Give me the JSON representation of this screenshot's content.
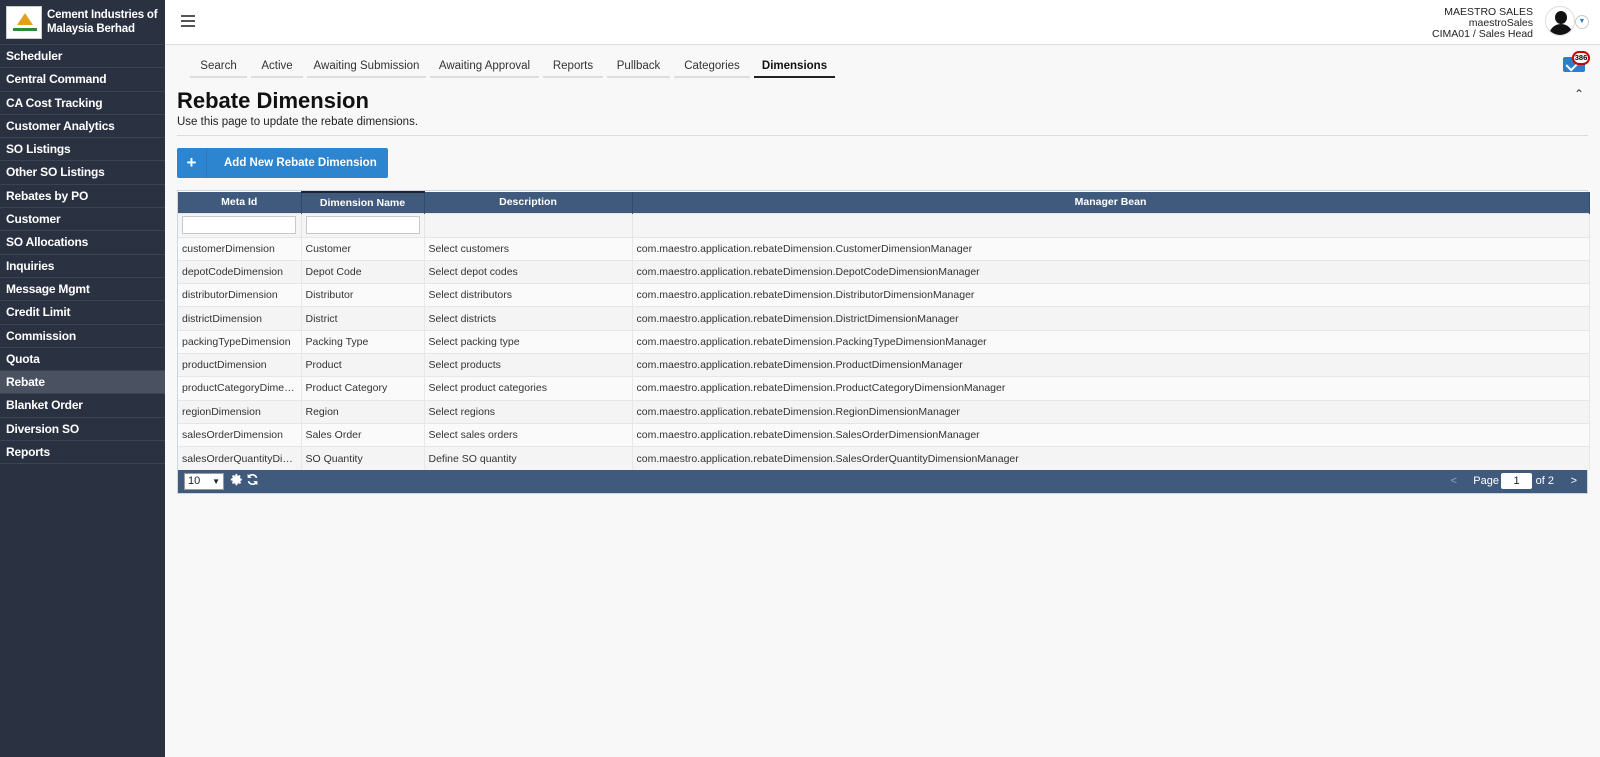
{
  "brand": {
    "name": "Cement Industries of Malaysia Berhad"
  },
  "sidebar": {
    "items": [
      {
        "label": "Scheduler",
        "name": "sidebar-item-scheduler"
      },
      {
        "label": "Central Command",
        "name": "sidebar-item-central-command"
      },
      {
        "label": "CA Cost Tracking",
        "name": "sidebar-item-ca-cost-tracking"
      },
      {
        "label": "Customer Analytics",
        "name": "sidebar-item-customer-analytics"
      },
      {
        "label": "SO Listings",
        "name": "sidebar-item-so-listings"
      },
      {
        "label": "Other SO Listings",
        "name": "sidebar-item-other-so-listings"
      },
      {
        "label": "Rebates by PO",
        "name": "sidebar-item-rebates-by-po"
      },
      {
        "label": "Customer",
        "name": "sidebar-item-customer"
      },
      {
        "label": "SO Allocations",
        "name": "sidebar-item-so-allocations"
      },
      {
        "label": "Inquiries",
        "name": "sidebar-item-inquiries"
      },
      {
        "label": "Message Mgmt",
        "name": "sidebar-item-message-mgmt"
      },
      {
        "label": "Credit Limit",
        "name": "sidebar-item-credit-limit"
      },
      {
        "label": "Commission",
        "name": "sidebar-item-commission"
      },
      {
        "label": "Quota",
        "name": "sidebar-item-quota"
      },
      {
        "label": "Rebate",
        "name": "sidebar-item-rebate",
        "active": true
      },
      {
        "label": "Blanket Order",
        "name": "sidebar-item-blanket-order"
      },
      {
        "label": "Diversion SO",
        "name": "sidebar-item-diversion-so"
      },
      {
        "label": "Reports",
        "name": "sidebar-item-reports"
      }
    ]
  },
  "user": {
    "display_name": "MAESTRO SALES",
    "username": "maestroSales",
    "role": "CIMA01 / Sales Head"
  },
  "tabs": [
    {
      "label": "Search",
      "width": 57
    },
    {
      "label": "Active",
      "width": 52
    },
    {
      "label": "Awaiting Submission",
      "width": 119
    },
    {
      "label": "Awaiting Approval",
      "width": 109
    },
    {
      "label": "Reports",
      "width": 60
    },
    {
      "label": "Pullback",
      "width": 63
    },
    {
      "label": "Categories",
      "width": 76
    },
    {
      "label": "Dimensions",
      "width": 81,
      "active": true
    }
  ],
  "mail": {
    "count": "386"
  },
  "page": {
    "title": "Rebate Dimension",
    "subtitle": "Use this page to update the rebate dimensions.",
    "add_button": "Add New Rebate Dimension"
  },
  "table": {
    "columns": [
      "Meta Id",
      "Dimension Name",
      "Description",
      "Manager Bean"
    ],
    "rows": [
      [
        "customerDimension",
        "Customer",
        "Select customers",
        "com.maestro.application.rebateDimension.CustomerDimensionManager"
      ],
      [
        "depotCodeDimension",
        "Depot Code",
        "Select depot codes",
        "com.maestro.application.rebateDimension.DepotCodeDimensionManager"
      ],
      [
        "distributorDimension",
        "Distributor",
        "Select distributors",
        "com.maestro.application.rebateDimension.DistributorDimensionManager"
      ],
      [
        "districtDimension",
        "District",
        "Select districts",
        "com.maestro.application.rebateDimension.DistrictDimensionManager"
      ],
      [
        "packingTypeDimension",
        "Packing Type",
        "Select packing type",
        "com.maestro.application.rebateDimension.PackingTypeDimensionManager"
      ],
      [
        "productDimension",
        "Product",
        "Select products",
        "com.maestro.application.rebateDimension.ProductDimensionManager"
      ],
      [
        "productCategoryDimens...",
        "Product Category",
        "Select product categories",
        "com.maestro.application.rebateDimension.ProductCategoryDimensionManager"
      ],
      [
        "regionDimension",
        "Region",
        "Select regions",
        "com.maestro.application.rebateDimension.RegionDimensionManager"
      ],
      [
        "salesOrderDimension",
        "Sales Order",
        "Select sales orders",
        "com.maestro.application.rebateDimension.SalesOrderDimensionManager"
      ],
      [
        "salesOrderQuantityDime...",
        "SO Quantity",
        "Define SO quantity",
        "com.maestro.application.rebateDimension.SalesOrderQuantityDimensionManager"
      ]
    ]
  },
  "paginator": {
    "page_size": "10",
    "prev": "<",
    "page_label": "Page",
    "current_page": "1",
    "of_label": "of 2",
    "next": ">"
  }
}
